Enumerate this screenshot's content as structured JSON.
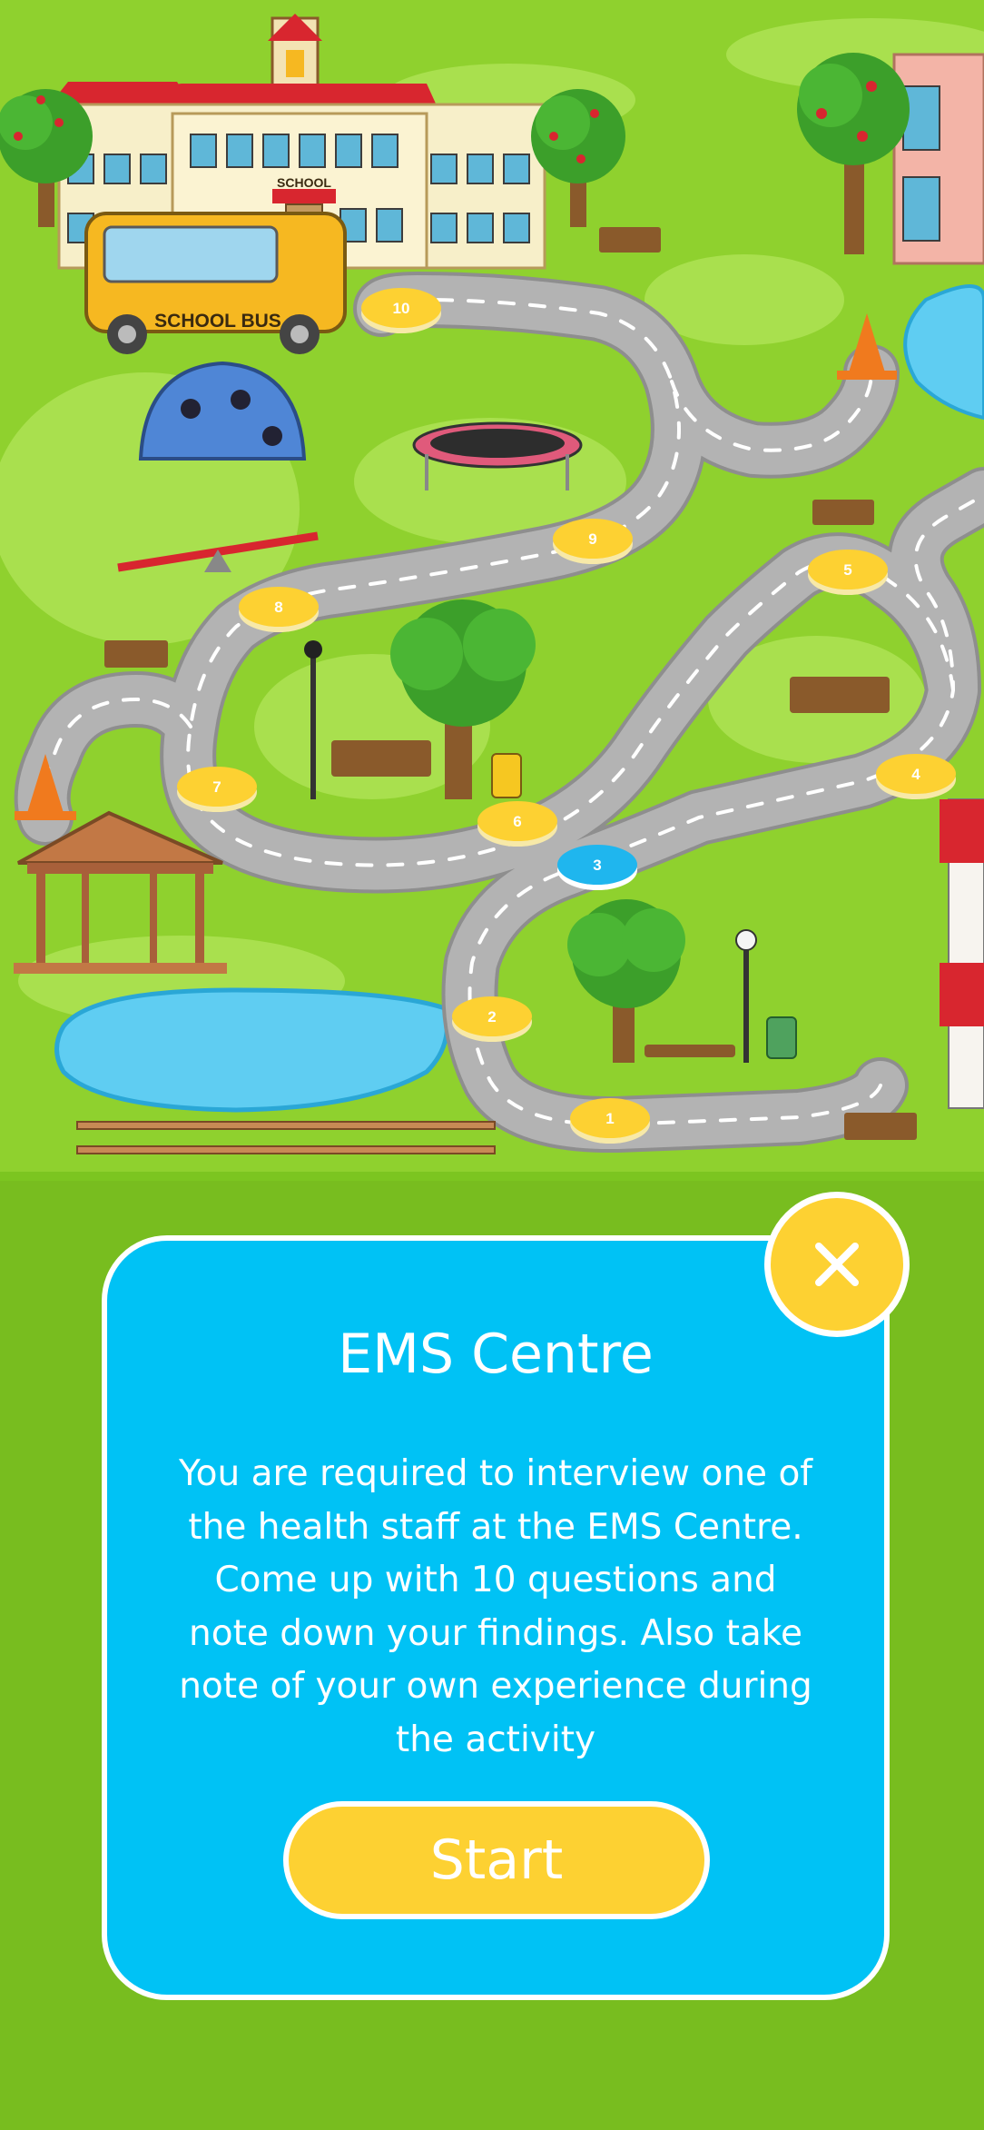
{
  "map": {
    "school_sign": "SCHOOL",
    "bus_label": "SCHOOL BUS",
    "levels": [
      {
        "number": "1",
        "state": "locked"
      },
      {
        "number": "2",
        "state": "locked"
      },
      {
        "number": "3",
        "state": "current"
      },
      {
        "number": "4",
        "state": "locked"
      },
      {
        "number": "5",
        "state": "locked"
      },
      {
        "number": "6",
        "state": "locked"
      },
      {
        "number": "7",
        "state": "locked"
      },
      {
        "number": "8",
        "state": "locked"
      },
      {
        "number": "9",
        "state": "locked"
      },
      {
        "number": "10",
        "state": "locked"
      }
    ]
  },
  "dialog": {
    "title": "EMS Centre",
    "description": "You are required to interview one of the health staff at the EMS Centre. Come up with 10 questions and note down your findings. Also take note of your own experience during the activity",
    "start_label": "Start",
    "close_icon": "close-icon"
  },
  "colors": {
    "background": "#78bd1f",
    "dialog": "#00c2f5",
    "button": "#fdd132",
    "marker_locked": "#fdd132",
    "marker_current": "#1fb6ee"
  }
}
